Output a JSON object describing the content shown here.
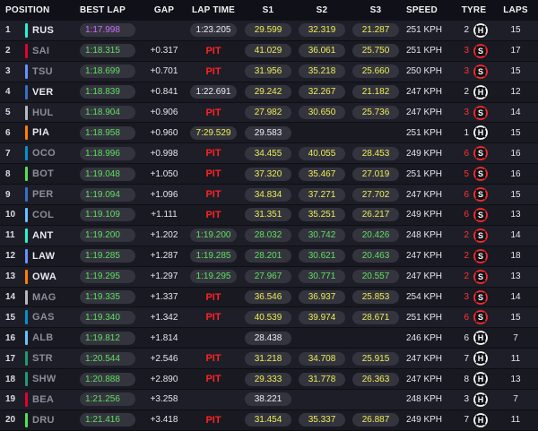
{
  "colors": {
    "background": "#15151e",
    "personal_best": "#5fe05f",
    "overall_best": "#c870ff",
    "sector_time": "#eded55",
    "pit": "#ff2222",
    "soft_tyre": "#ff2a2a",
    "hard_tyre": "#ffffff"
  },
  "headers": {
    "position": "POSITION",
    "best_lap": "BEST LAP",
    "gap": "GAP",
    "lap_time": "LAP TIME",
    "s1": "S1",
    "s2": "S2",
    "s3": "S3",
    "speed": "SPEED",
    "tyre": "TYRE",
    "laps": "LAPS"
  },
  "rows": [
    {
      "pos": "1",
      "code": "RUS",
      "team_color": "#27f4d2",
      "dim": false,
      "best": "1:17.998",
      "best_color": "purple",
      "gap": "",
      "lap": "1:23.205",
      "lap_color": "white",
      "s1": "29.599",
      "s1_color": "yellow",
      "s2": "32.319",
      "s2_color": "yellow",
      "s3": "21.287",
      "s3_color": "yellow",
      "speed": "251 KPH",
      "tyre_count": "2",
      "tyre_count_color": "white",
      "compound": "H",
      "tyre_icon": "hard-tyre-icon",
      "laps": "15"
    },
    {
      "pos": "2",
      "code": "SAI",
      "team_color": "#e8002d",
      "dim": true,
      "best": "1:18.315",
      "best_color": "green",
      "gap": "+0.317",
      "lap": "PIT",
      "lap_color": "pit",
      "s1": "41.029",
      "s1_color": "yellow",
      "s2": "36.061",
      "s2_color": "yellow",
      "s3": "25.750",
      "s3_color": "yellow",
      "speed": "251 KPH",
      "tyre_count": "3",
      "tyre_count_color": "red",
      "compound": "S",
      "tyre_icon": "soft-tyre-icon",
      "laps": "17"
    },
    {
      "pos": "3",
      "code": "TSU",
      "team_color": "#6692ff",
      "dim": true,
      "best": "1:18.699",
      "best_color": "green",
      "gap": "+0.701",
      "lap": "PIT",
      "lap_color": "pit",
      "s1": "31.956",
      "s1_color": "yellow",
      "s2": "35.218",
      "s2_color": "yellow",
      "s3": "25.660",
      "s3_color": "yellow",
      "speed": "250 KPH",
      "tyre_count": "3",
      "tyre_count_color": "red",
      "compound": "S",
      "tyre_icon": "soft-tyre-icon",
      "laps": "15"
    },
    {
      "pos": "4",
      "code": "VER",
      "team_color": "#3671c6",
      "dim": false,
      "best": "1:18.839",
      "best_color": "green",
      "gap": "+0.841",
      "lap": "1:22.691",
      "lap_color": "white",
      "s1": "29.242",
      "s1_color": "yellow",
      "s2": "32.267",
      "s2_color": "yellow",
      "s3": "21.182",
      "s3_color": "yellow",
      "speed": "247 KPH",
      "tyre_count": "2",
      "tyre_count_color": "white",
      "compound": "H",
      "tyre_icon": "hard-tyre-icon",
      "laps": "12"
    },
    {
      "pos": "5",
      "code": "HUL",
      "team_color": "#b6babd",
      "dim": true,
      "best": "1:18.904",
      "best_color": "green",
      "gap": "+0.906",
      "lap": "PIT",
      "lap_color": "pit",
      "s1": "27.982",
      "s1_color": "yellow",
      "s2": "30.650",
      "s2_color": "yellow",
      "s3": "25.736",
      "s3_color": "yellow",
      "speed": "247 KPH",
      "tyre_count": "3",
      "tyre_count_color": "red",
      "compound": "S",
      "tyre_icon": "soft-tyre-icon",
      "laps": "14"
    },
    {
      "pos": "6",
      "code": "PIA",
      "team_color": "#ff8000",
      "dim": false,
      "best": "1:18.958",
      "best_color": "green",
      "gap": "+0.960",
      "lap": "7:29.529",
      "lap_color": "yellow",
      "s1": "29.583",
      "s1_color": "white",
      "s2": "",
      "s2_color": "white",
      "s3": "",
      "s3_color": "white",
      "speed": "251 KPH",
      "tyre_count": "1",
      "tyre_count_color": "white",
      "compound": "H",
      "tyre_icon": "hard-tyre-icon",
      "laps": "15"
    },
    {
      "pos": "7",
      "code": "OCO",
      "team_color": "#0093cc",
      "dim": true,
      "best": "1:18.996",
      "best_color": "green",
      "gap": "+0.998",
      "lap": "PIT",
      "lap_color": "pit",
      "s1": "34.455",
      "s1_color": "yellow",
      "s2": "40.055",
      "s2_color": "yellow",
      "s3": "28.453",
      "s3_color": "yellow",
      "speed": "249 KPH",
      "tyre_count": "6",
      "tyre_count_color": "red",
      "compound": "S",
      "tyre_icon": "soft-tyre-icon",
      "laps": "16"
    },
    {
      "pos": "8",
      "code": "BOT",
      "team_color": "#52e252",
      "dim": true,
      "best": "1:19.048",
      "best_color": "green",
      "gap": "+1.050",
      "lap": "PIT",
      "lap_color": "pit",
      "s1": "37.320",
      "s1_color": "yellow",
      "s2": "35.467",
      "s2_color": "yellow",
      "s3": "27.019",
      "s3_color": "yellow",
      "speed": "251 KPH",
      "tyre_count": "5",
      "tyre_count_color": "red",
      "compound": "S",
      "tyre_icon": "soft-tyre-icon",
      "laps": "16"
    },
    {
      "pos": "9",
      "code": "PER",
      "team_color": "#3671c6",
      "dim": true,
      "best": "1:19.094",
      "best_color": "green",
      "gap": "+1.096",
      "lap": "PIT",
      "lap_color": "pit",
      "s1": "34.834",
      "s1_color": "yellow",
      "s2": "37.271",
      "s2_color": "yellow",
      "s3": "27.702",
      "s3_color": "yellow",
      "speed": "247 KPH",
      "tyre_count": "6",
      "tyre_count_color": "red",
      "compound": "S",
      "tyre_icon": "soft-tyre-icon",
      "laps": "15"
    },
    {
      "pos": "10",
      "code": "COL",
      "team_color": "#64c4ff",
      "dim": true,
      "best": "1:19.109",
      "best_color": "green",
      "gap": "+1.111",
      "lap": "PIT",
      "lap_color": "pit",
      "s1": "31.351",
      "s1_color": "yellow",
      "s2": "35.251",
      "s2_color": "yellow",
      "s3": "26.217",
      "s3_color": "yellow",
      "speed": "249 KPH",
      "tyre_count": "6",
      "tyre_count_color": "red",
      "compound": "S",
      "tyre_icon": "soft-tyre-icon",
      "laps": "13"
    },
    {
      "pos": "11",
      "code": "ANT",
      "team_color": "#27f4d2",
      "dim": false,
      "best": "1:19.200",
      "best_color": "green",
      "gap": "+1.202",
      "lap": "1:19.200",
      "lap_color": "green",
      "s1": "28.032",
      "s1_color": "green",
      "s2": "30.742",
      "s2_color": "green",
      "s3": "20.426",
      "s3_color": "green",
      "speed": "248 KPH",
      "tyre_count": "2",
      "tyre_count_color": "red",
      "compound": "S",
      "tyre_icon": "soft-tyre-icon",
      "laps": "14"
    },
    {
      "pos": "12",
      "code": "LAW",
      "team_color": "#6692ff",
      "dim": false,
      "best": "1:19.285",
      "best_color": "green",
      "gap": "+1.287",
      "lap": "1:19.285",
      "lap_color": "green",
      "s1": "28.201",
      "s1_color": "green",
      "s2": "30.621",
      "s2_color": "green",
      "s3": "20.463",
      "s3_color": "green",
      "speed": "247 KPH",
      "tyre_count": "2",
      "tyre_count_color": "red",
      "compound": "S",
      "tyre_icon": "soft-tyre-icon",
      "laps": "18"
    },
    {
      "pos": "13",
      "code": "OWA",
      "team_color": "#ff8000",
      "dim": false,
      "best": "1:19.295",
      "best_color": "green",
      "gap": "+1.297",
      "lap": "1:19.295",
      "lap_color": "green",
      "s1": "27.967",
      "s1_color": "green",
      "s2": "30.771",
      "s2_color": "green",
      "s3": "20.557",
      "s3_color": "green",
      "speed": "247 KPH",
      "tyre_count": "2",
      "tyre_count_color": "red",
      "compound": "S",
      "tyre_icon": "soft-tyre-icon",
      "laps": "13"
    },
    {
      "pos": "14",
      "code": "MAG",
      "team_color": "#b6babd",
      "dim": true,
      "best": "1:19.335",
      "best_color": "green",
      "gap": "+1.337",
      "lap": "PIT",
      "lap_color": "pit",
      "s1": "36.546",
      "s1_color": "yellow",
      "s2": "36.937",
      "s2_color": "yellow",
      "s3": "25.853",
      "s3_color": "yellow",
      "speed": "254 KPH",
      "tyre_count": "3",
      "tyre_count_color": "red",
      "compound": "S",
      "tyre_icon": "soft-tyre-icon",
      "laps": "14"
    },
    {
      "pos": "15",
      "code": "GAS",
      "team_color": "#0093cc",
      "dim": true,
      "best": "1:19.340",
      "best_color": "green",
      "gap": "+1.342",
      "lap": "PIT",
      "lap_color": "pit",
      "s1": "40.539",
      "s1_color": "yellow",
      "s2": "39.974",
      "s2_color": "yellow",
      "s3": "28.671",
      "s3_color": "yellow",
      "speed": "251 KPH",
      "tyre_count": "6",
      "tyre_count_color": "red",
      "compound": "S",
      "tyre_icon": "soft-tyre-icon",
      "laps": "15"
    },
    {
      "pos": "16",
      "code": "ALB",
      "team_color": "#64c4ff",
      "dim": true,
      "best": "1:19.812",
      "best_color": "green",
      "gap": "+1.814",
      "lap": "",
      "lap_color": "white",
      "s1": "28.438",
      "s1_color": "white",
      "s2": "",
      "s2_color": "white",
      "s3": "",
      "s3_color": "white",
      "speed": "246 KPH",
      "tyre_count": "6",
      "tyre_count_color": "white",
      "compound": "H",
      "tyre_icon": "hard-tyre-icon",
      "laps": "7"
    },
    {
      "pos": "17",
      "code": "STR",
      "team_color": "#229971",
      "dim": true,
      "best": "1:20.544",
      "best_color": "green",
      "gap": "+2.546",
      "lap": "PIT",
      "lap_color": "pit",
      "s1": "31.218",
      "s1_color": "yellow",
      "s2": "34.708",
      "s2_color": "yellow",
      "s3": "25.915",
      "s3_color": "yellow",
      "speed": "247 KPH",
      "tyre_count": "7",
      "tyre_count_color": "white",
      "compound": "H",
      "tyre_icon": "hard-tyre-icon",
      "laps": "11"
    },
    {
      "pos": "18",
      "code": "SHW",
      "team_color": "#229971",
      "dim": true,
      "best": "1:20.888",
      "best_color": "green",
      "gap": "+2.890",
      "lap": "PIT",
      "lap_color": "pit",
      "s1": "29.333",
      "s1_color": "yellow",
      "s2": "31.778",
      "s2_color": "yellow",
      "s3": "26.363",
      "s3_color": "yellow",
      "speed": "247 KPH",
      "tyre_count": "8",
      "tyre_count_color": "white",
      "compound": "H",
      "tyre_icon": "hard-tyre-icon",
      "laps": "13"
    },
    {
      "pos": "19",
      "code": "BEA",
      "team_color": "#e8002d",
      "dim": true,
      "best": "1:21.256",
      "best_color": "green",
      "gap": "+3.258",
      "lap": "",
      "lap_color": "white",
      "s1": "38.221",
      "s1_color": "white",
      "s2": "",
      "s2_color": "white",
      "s3": "",
      "s3_color": "white",
      "speed": "248 KPH",
      "tyre_count": "3",
      "tyre_count_color": "white",
      "compound": "H",
      "tyre_icon": "hard-tyre-icon",
      "laps": "7"
    },
    {
      "pos": "20",
      "code": "DRU",
      "team_color": "#52e252",
      "dim": true,
      "best": "1:21.416",
      "best_color": "green",
      "gap": "+3.418",
      "lap": "PIT",
      "lap_color": "pit",
      "s1": "31.454",
      "s1_color": "yellow",
      "s2": "35.337",
      "s2_color": "yellow",
      "s3": "26.887",
      "s3_color": "yellow",
      "speed": "249 KPH",
      "tyre_count": "7",
      "tyre_count_color": "white",
      "compound": "H",
      "tyre_icon": "hard-tyre-icon",
      "laps": "11"
    }
  ]
}
